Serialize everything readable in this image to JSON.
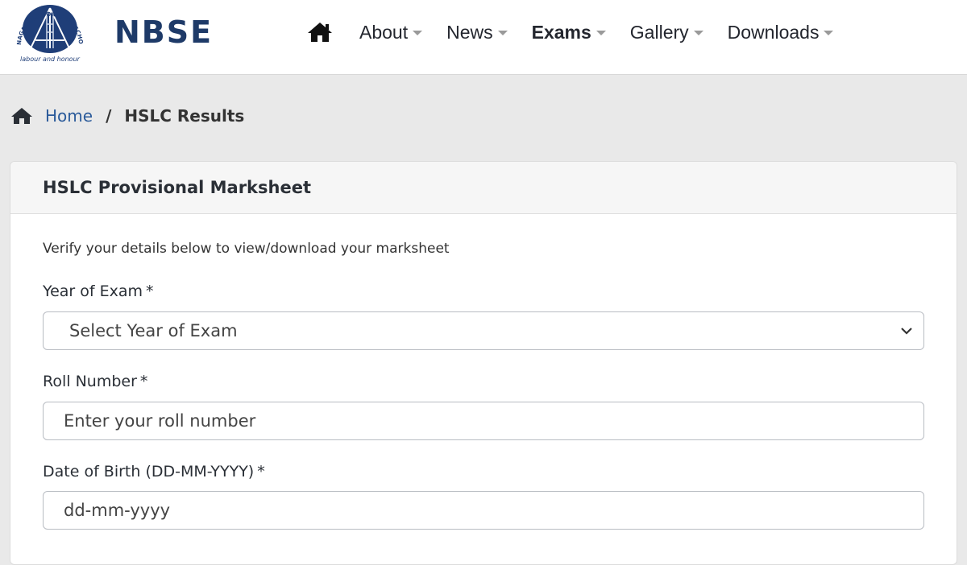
{
  "header": {
    "logo": {
      "ring_text": "NAGALAND BOARD OF SCHOOL EDUCATION",
      "motto": "labour and honour",
      "icon": "nbse-emblem-icon"
    },
    "brand": "NBSE",
    "nav": {
      "home_icon": "home-icon",
      "items": [
        {
          "label": "About",
          "active": false,
          "icon": "caret-down-icon"
        },
        {
          "label": "News",
          "active": false,
          "icon": "caret-down-icon"
        },
        {
          "label": "Exams",
          "active": true,
          "icon": "caret-down-icon"
        },
        {
          "label": "Gallery",
          "active": false,
          "icon": "caret-down-icon"
        },
        {
          "label": "Downloads",
          "active": false,
          "icon": "caret-down-icon"
        }
      ]
    }
  },
  "breadcrumb": {
    "home_icon": "home-icon",
    "home_label": "Home",
    "separator": "/",
    "current": "HSLC Results"
  },
  "card": {
    "title": "HSLC Provisional Marksheet",
    "intro": "Verify your details below to view/download your marksheet",
    "fields": [
      {
        "label": "Year of Exam",
        "required_mark": "*",
        "type": "select",
        "value": "Select Year of Exam",
        "icon": "chevron-down-icon"
      },
      {
        "label": "Roll Number",
        "required_mark": "*",
        "type": "text",
        "placeholder": "Enter your roll number"
      },
      {
        "label": "Date of Birth (DD-MM-YYYY)",
        "required_mark": "*",
        "type": "date",
        "placeholder": "dd-mm-yyyy"
      }
    ]
  },
  "colors": {
    "brand": "#1e3a68",
    "link": "#2a5a9a",
    "page_bg": "#e9e9e9",
    "card_header_bg": "#f6f6f6"
  }
}
